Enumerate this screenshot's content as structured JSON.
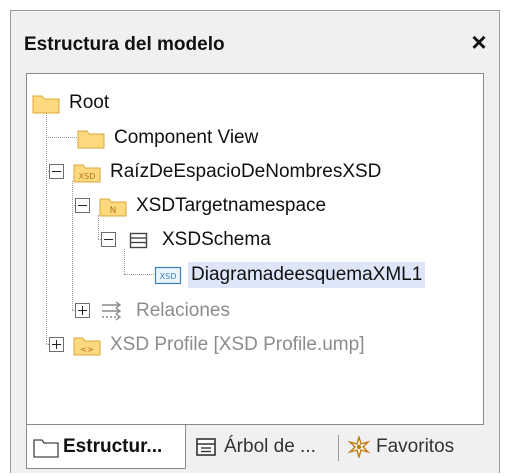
{
  "panel": {
    "title": "Estructura del modelo",
    "close_glyph": "×"
  },
  "tree": {
    "root": {
      "label": "Root",
      "icon": "folder-icon"
    },
    "component_view": {
      "label": "Component View",
      "icon": "folder-icon"
    },
    "xsd_namespace_root": {
      "label": "RaízDeEspacioDeNombresXSD",
      "icon": "xsd-package-icon",
      "icon_text": "XSD"
    },
    "xsd_target_namespace": {
      "label": "XSDTargetnamespace",
      "icon": "namespace-package-icon",
      "icon_text": "N"
    },
    "xsd_schema": {
      "label": "XSDSchema",
      "icon": "schema-icon"
    },
    "xml_schema_diagram": {
      "label": "DiagramadeesquemaXML1",
      "icon": "xsd-diagram-icon",
      "icon_text": "XSD",
      "selected": true
    },
    "relations": {
      "label": "Relaciones",
      "icon": "relations-icon"
    },
    "xsd_profile": {
      "label": "XSD Profile [XSD Profile.ump]",
      "icon": "profile-package-icon",
      "icon_text": "<>"
    }
  },
  "tabs": [
    {
      "label": "Estructur...",
      "icon": "folder-tab-icon",
      "active": true
    },
    {
      "label": "Árbol de ...",
      "icon": "diagram-tree-icon",
      "active": false
    },
    {
      "label": "Favoritos",
      "icon": "favorites-icon",
      "active": false
    }
  ],
  "colors": {
    "folder_fill": "#fcd97c",
    "folder_edge": "#d9a83a",
    "selection": "#dde6f8",
    "diagram_icon": "#3a7fbf",
    "dim_text": "#8c8c8c"
  }
}
